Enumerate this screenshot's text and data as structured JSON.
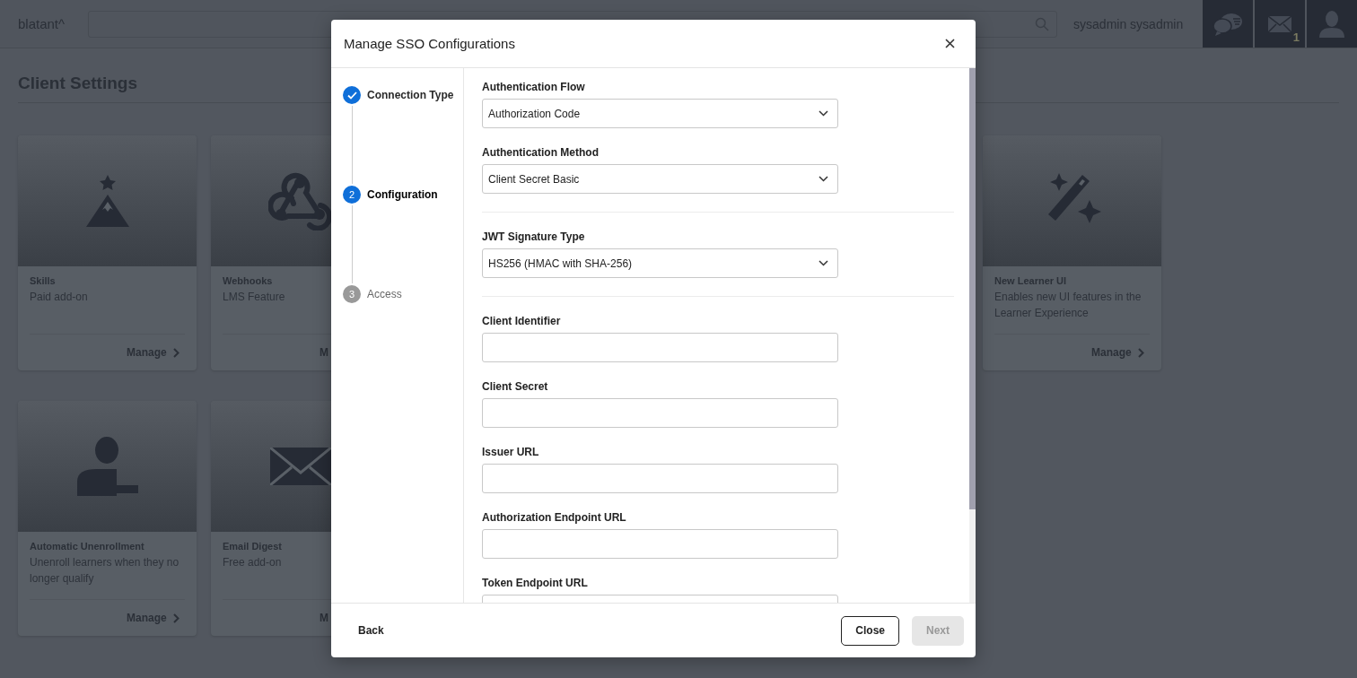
{
  "header": {
    "logo": "blatant^",
    "user": "sysadmin sysadmin",
    "mail_count": "1"
  },
  "page": {
    "title": "Client Settings"
  },
  "card_rows": [
    [
      {
        "kind": "skills",
        "title": "Skills",
        "subtitle": "Paid add-on",
        "action": "Manage"
      },
      {
        "kind": "webhook",
        "title": "Webhooks",
        "subtitle": "LMS Feature",
        "action": "M"
      },
      {
        "kind": "wand",
        "title": "New Learner UI",
        "subtitle": "Enables new UI features in the Learner Experience",
        "action": "Manage"
      }
    ],
    [
      {
        "kind": "unenroll",
        "title": "Automatic Unenrollment",
        "subtitle": "Unenroll learners when they no longer qualify",
        "action": "Manage"
      },
      {
        "kind": "mail",
        "title": "Email Digest",
        "subtitle": "Free add-on",
        "action": "M"
      }
    ]
  ],
  "modal": {
    "title": "Manage SSO Configurations",
    "steps": [
      {
        "label": "Connection Type",
        "completed": true,
        "selected": false
      },
      {
        "number": "2",
        "label": "Configuration",
        "completed": false,
        "selected": true
      },
      {
        "number": "3",
        "label": "Access",
        "completed": false,
        "selected": false
      }
    ],
    "sections": [
      {
        "fields": [
          {
            "label": "Authentication Flow",
            "kind": "select",
            "value": "Authorization Code"
          },
          {
            "label": "Authentication Method",
            "kind": "select",
            "value": "Client Secret Basic"
          }
        ]
      },
      {
        "fields": [
          {
            "label": "JWT Signature Type",
            "kind": "select",
            "value": "HS256 (HMAC with SHA-256)"
          }
        ]
      },
      {
        "fields": [
          {
            "label": "Client Identifier",
            "kind": "input"
          },
          {
            "label": "Client Secret",
            "kind": "input"
          },
          {
            "label": "Issuer URL",
            "kind": "input"
          },
          {
            "label": "Authorization Endpoint URL",
            "kind": "input"
          },
          {
            "label": "Token Endpoint URL",
            "kind": "input"
          }
        ]
      }
    ],
    "back": "Back",
    "close": "Close",
    "next": {
      "label": "Next",
      "disabled": true
    }
  }
}
